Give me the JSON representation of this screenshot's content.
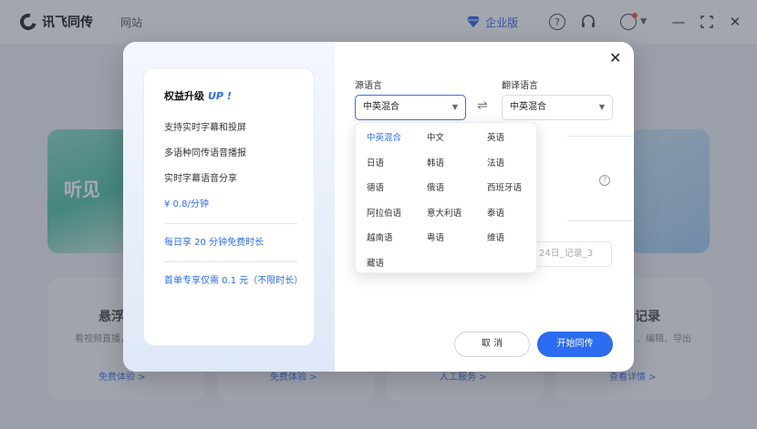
{
  "app": {
    "name": "讯飞同传",
    "nav_link": "网站",
    "enterprise_label": "企业版",
    "help_glyph": "?"
  },
  "background": {
    "banner_text": "听见",
    "cards": [
      {
        "title": "悬浮",
        "sub": "看视频直播，",
        "link": "免费体验 >"
      },
      {
        "title": "",
        "sub": "",
        "link": "免费体验 >"
      },
      {
        "title": "",
        "sub": "",
        "link": "人工服务 >"
      },
      {
        "title": "记录",
        "sub": "、编辑、导出",
        "link": "查看详情 >"
      }
    ]
  },
  "benefits": {
    "title": "权益升级",
    "up_tag": "UP !",
    "lines": [
      "支持实时字幕和投屏",
      "多语种同传语音播报",
      "实时字幕语音分享"
    ],
    "price": "¥ 0.8/分钟",
    "daily": "每日享 20 分钟免费时长",
    "first": "首单专享仅需 0.1 元（不限时长）"
  },
  "form": {
    "source_label": "源语言",
    "target_label": "翻译语言",
    "source_value": "中英混合",
    "target_value": "中英混合",
    "record_name_value": "24日_记录_3",
    "cancel_label": "取 消",
    "start_label": "开始同传"
  },
  "dropdown": {
    "selected": "中英混合",
    "options": [
      "中英混合",
      "中文",
      "英语",
      "日语",
      "韩语",
      "法语",
      "德语",
      "俄语",
      "西班牙语",
      "阿拉伯语",
      "意大利语",
      "泰语",
      "越南语",
      "粤语",
      "维语",
      "藏语"
    ]
  },
  "colors": {
    "accent": "#2b6cf0",
    "enterprise": "#2b5fe6"
  }
}
